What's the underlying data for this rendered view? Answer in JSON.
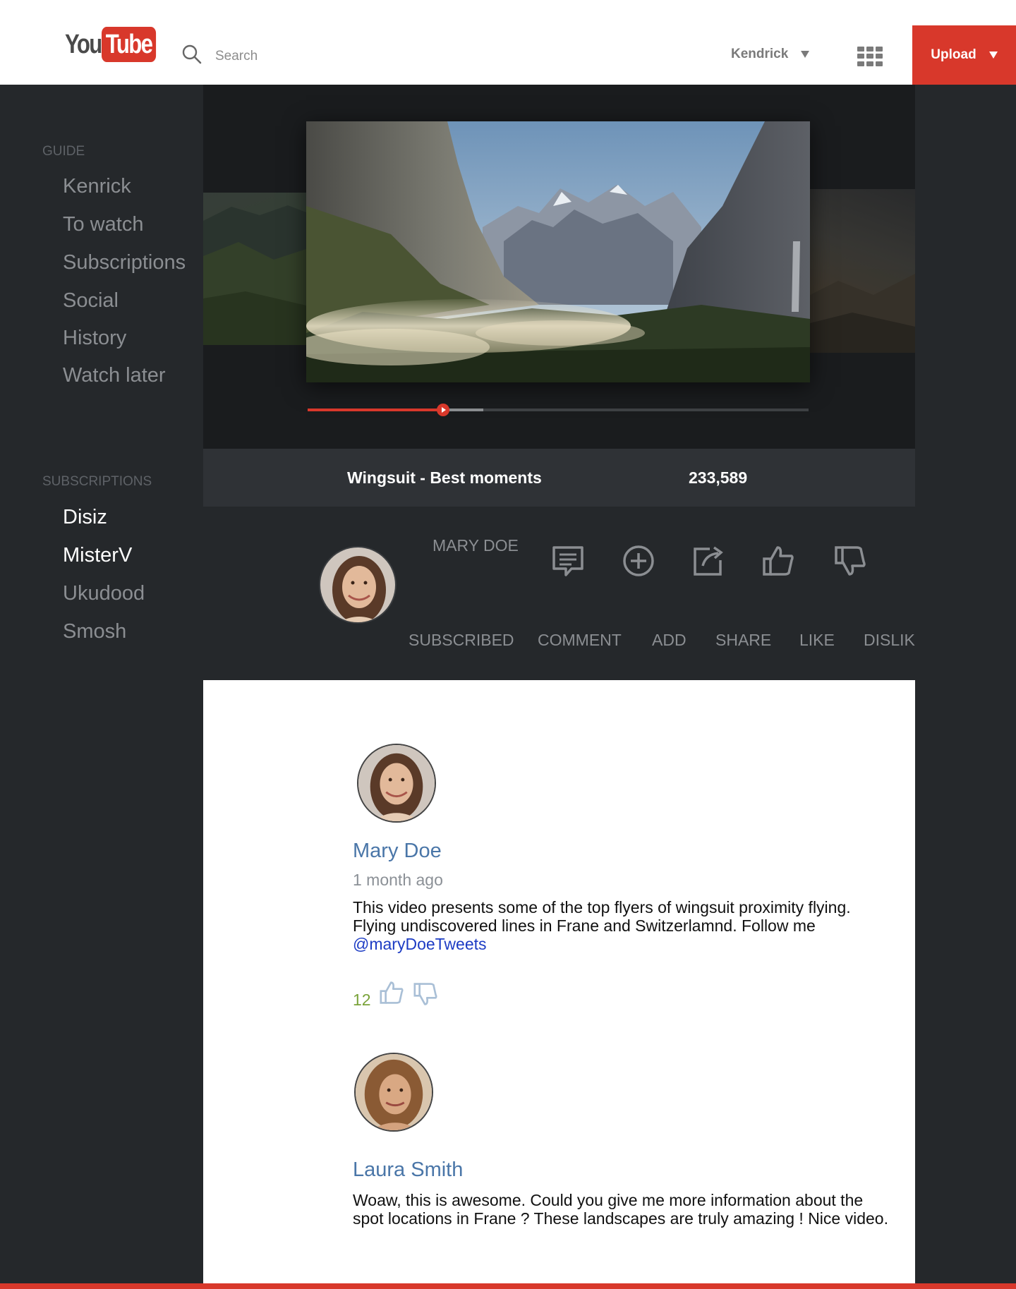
{
  "header": {
    "logo": {
      "part1": "You",
      "part2": "Tube"
    },
    "search": {
      "placeholder": "Search"
    },
    "user": {
      "name": "Kendrick"
    },
    "upload_label": "Upload"
  },
  "sidebar": {
    "guide_title": "GUIDE",
    "guide_items": [
      "Kenrick",
      "To watch",
      "Subscriptions",
      "Social",
      "History",
      "Watch later"
    ],
    "subscriptions_title": "SUBSCRIPTIONS",
    "subscription_items": [
      "Disiz",
      "MisterV",
      "Ukudood",
      "Smosh"
    ]
  },
  "video": {
    "title": "Wingsuit - Best moments",
    "views": "233,589",
    "progress_played": 0.27,
    "progress_buffered": 0.35
  },
  "channel": {
    "name": "MARY DOE",
    "actions": [
      "SUBSCRIBED",
      "COMMENT",
      "ADD",
      "SHARE",
      "LIKE",
      "DISLIK"
    ]
  },
  "comments": [
    {
      "author": "Mary Doe",
      "time": "1 month ago",
      "text": "This video presents some of the top flyers of wingsuit proximity flying. Flying undiscovered lines in Frane and Switzerlamnd. Follow me",
      "link": "@maryDoeTweets",
      "likes": "12"
    },
    {
      "author": "Laura Smith",
      "text": "Woaw, this is awesome. Could you give me more information about the spot locations in Frane ? These landscapes are truly amazing ! Nice video."
    }
  ],
  "colors": {
    "brand_red": "#d8382b",
    "sidebar_bg": "#25282b",
    "link_blue": "#4a76a8",
    "like_green": "#7aa33a"
  }
}
